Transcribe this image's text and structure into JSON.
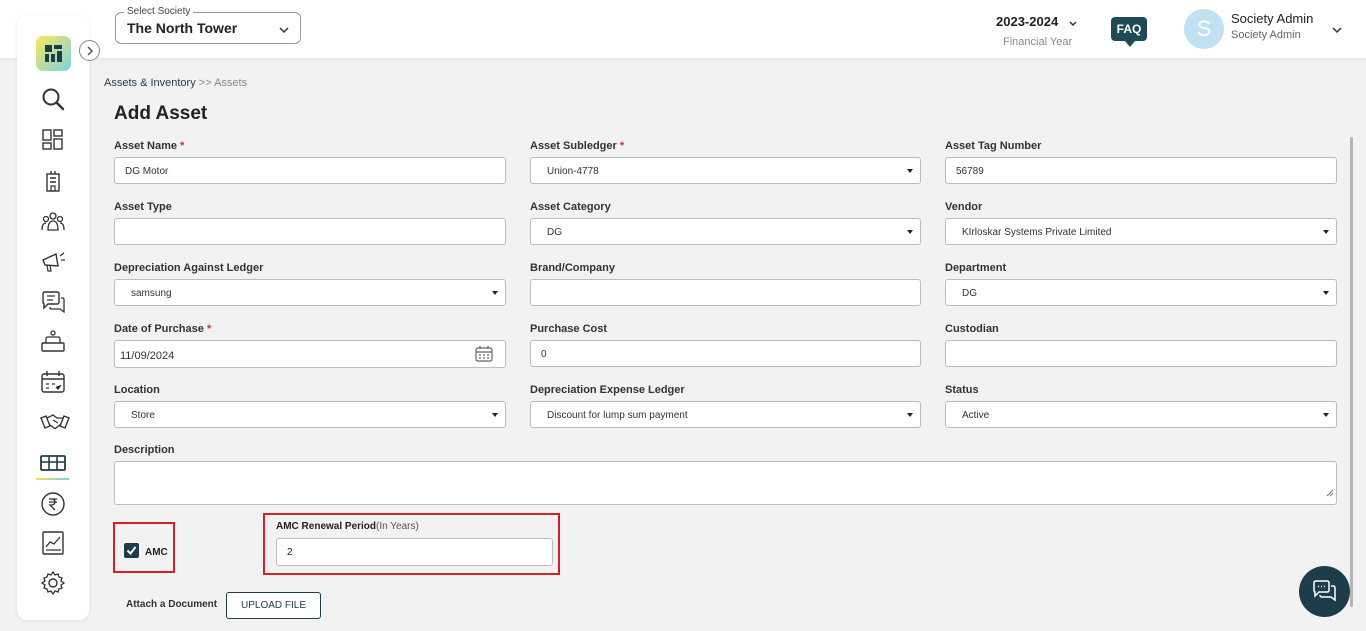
{
  "header": {
    "society_label": "Select Society",
    "society_value": "The North Tower",
    "financial_year": "2023-2024",
    "financial_year_label": "Financial Year",
    "faq": "FAQ",
    "avatar_initial": "S",
    "user_name": "Society Admin",
    "user_role": "Society Admin"
  },
  "sidebar": {
    "icons": [
      "search-icon",
      "dashboard-icon",
      "building-icon",
      "members-icon",
      "announcement-icon",
      "chat-icon",
      "service-icon",
      "calendar-icon",
      "handshake-icon",
      "assets-icon",
      "rupee-icon",
      "report-icon",
      "settings-icon"
    ],
    "active": "assets-icon"
  },
  "breadcrumb": {
    "parent": "Assets & Inventory",
    "separator": ">>",
    "current": "Assets"
  },
  "page_title": "Add Asset",
  "form": {
    "asset_name": {
      "label": "Asset Name",
      "value": "DG Motor"
    },
    "asset_subledger": {
      "label": "Asset Subledger",
      "value": "Union-4778"
    },
    "asset_tag": {
      "label": "Asset Tag Number",
      "value": "56789"
    },
    "asset_type": {
      "label": "Asset Type",
      "value": ""
    },
    "asset_category": {
      "label": "Asset Category",
      "value": "DG"
    },
    "vendor": {
      "label": "Vendor",
      "value": "KIrloskar Systems Private Limited"
    },
    "depreciation_ledger": {
      "label": "Depreciation Against Ledger",
      "value": "samsung"
    },
    "brand": {
      "label": "Brand/Company",
      "value": ""
    },
    "department": {
      "label": "Department",
      "value": "DG"
    },
    "date_of_purchase": {
      "label": "Date of Purchase",
      "value": "11/09/2024"
    },
    "purchase_cost": {
      "label": "Purchase Cost",
      "value": "0"
    },
    "custodian": {
      "label": "Custodian",
      "value": ""
    },
    "location": {
      "label": "Location",
      "value": "Store"
    },
    "depreciation_expense": {
      "label": "Depreciation Expense Ledger",
      "value": "Discount for lump sum payment"
    },
    "status": {
      "label": "Status",
      "value": "Active"
    },
    "description": {
      "label": "Description",
      "value": ""
    },
    "amc": {
      "label": "AMC",
      "checked": true
    },
    "amc_renewal": {
      "label": "AMC Renewal Period",
      "unit": "(In Years)",
      "value": "2"
    },
    "attach_label": "Attach a Document",
    "upload_button": "UPLOAD FILE"
  },
  "colors": {
    "primary": "#1e3d4a",
    "highlight": "#d61f26",
    "required": "#d32f2f"
  }
}
